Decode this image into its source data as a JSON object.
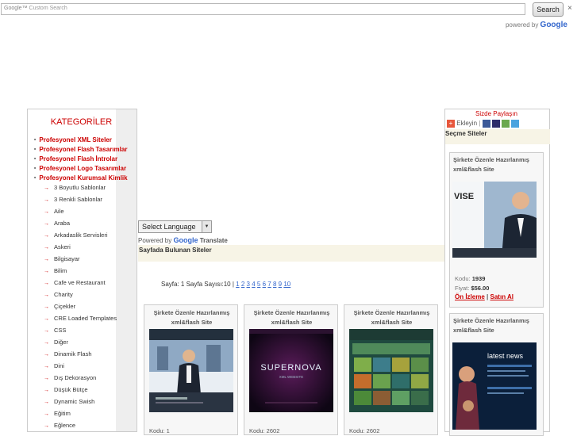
{
  "search": {
    "placeholder": "Custom Search",
    "button": "Search",
    "close": "×",
    "powered_prefix": "powered by",
    "powered_brand": "Google"
  },
  "sidebar": {
    "title": "KATEGORİLER",
    "bold_items": [
      "Profesyonel XML Siteler",
      "Profesyonel Flash Tasarımlar",
      "Profesyonel Flash İntrolar",
      "Profesyonel Logo Tasarımlar",
      "Profesyonel Kurumsal Kimlik"
    ],
    "items": [
      "3 Boyutlu Sablonlar",
      "3 Renkli Sablonlar",
      "Aile",
      "Araba",
      "Arkadaslik Servisleri",
      "Askeri",
      "Bilgisayar",
      "Bilim",
      "Cafe ve Restaurant",
      "Charity",
      "Çiçekler",
      "CRE Loaded Templates",
      "CSS",
      "Diğer",
      "Dinamik Flash",
      "Dini",
      "Dış Dekorasyon",
      "Düşük Bütçe",
      "Dynamic Swish",
      "Eğitim",
      "Eğlence"
    ]
  },
  "translate": {
    "select_label": "Select Language",
    "powered_prefix": "Powered by",
    "brand": "Google",
    "suffix": "Translate"
  },
  "main": {
    "found_title": "Sayfada Bulunan Siteler",
    "pages_prefix": "Sayfa: 1 Sayfa Sayısı:10 |",
    "pages": [
      "1",
      "2",
      "3",
      "4",
      "5",
      "6",
      "7",
      "8",
      "9",
      "10"
    ],
    "cards": [
      {
        "title": "Şirkete Özenle Hazırlanmış xml&flash Site",
        "code": "Kodu: 1"
      },
      {
        "title": "Şirkete Özenle Hazırlanmış xml&flash Site",
        "code": "Kodu: 2602"
      },
      {
        "title": "Şirkete Özenle Hazırlanmış xml&flash Site",
        "code": "Kodu: 2602"
      }
    ],
    "card_supernova": "SUPERNOVA",
    "card_supernova_sub": "XML WEBSITE"
  },
  "right": {
    "share": "Sizde Paylaşın",
    "add": "Ekleyin",
    "section": "Seçme Siteler",
    "cards": [
      {
        "title": "Şirkete Özenle Hazırlanmış xml&flash Site",
        "code_label": "Kodu:",
        "code": "1939",
        "price_label": "Fiyat:",
        "price": "$56.00",
        "view": "Ön İzleme",
        "buy": "Satın Al",
        "image_text": "VISE"
      },
      {
        "title": "Şirkete Özenle Hazırlanmış xml&flash Site",
        "image_text": "latest news"
      }
    ]
  },
  "colors": {
    "accent_red": "#cc0000",
    "link_blue": "#3366cc",
    "band": "#f7f4e6"
  }
}
